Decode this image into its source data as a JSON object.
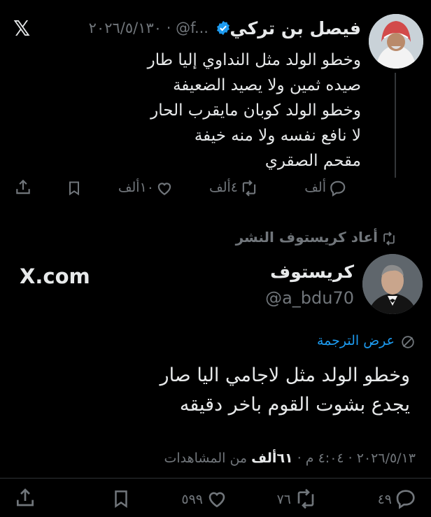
{
  "quoted_tweet": {
    "author_name": "فيصل بن تركي",
    "handle": "@f...",
    "date": "٢٠٢٦/٥/١٣٠",
    "platform_icon": "x-logo",
    "lines": [
      "وخطو الولد مثل النداوي إليا طار",
      "صيده ثمين ولا يصيد الضعيفة",
      "وخطو الولد كوبان مايقرب الحار",
      "لا نافع نفسه ولا منه خيفة",
      "مقحم الصقري"
    ],
    "actions": {
      "reply_count": "ألف",
      "retweet_count": "٤ألف",
      "like_count": "١٠ألف"
    }
  },
  "retweet_note": "أعاد كريستوف النشر",
  "tweet": {
    "author_name": "كريستوف",
    "handle": "@a_bdu70",
    "watermark": "X.com",
    "translate_label": "عرض الترجمة",
    "lines": [
      "وخطو الولد مثل لاجامي اليا صار",
      "يجدع بشوت القوم باخر دقيقه"
    ],
    "meta": {
      "time": "٤:٠٤ م",
      "date": "٢٠٢٦/٥/١٣",
      "views_count": "٦١ألف",
      "views_label": "من المشاهدات"
    },
    "actions": {
      "reply_count": "٤٩",
      "retweet_count": "٧٦",
      "like_count": "٥٩٩"
    }
  },
  "colors": {
    "background": "#000000",
    "text": "#e7e9ea",
    "muted": "#71767b",
    "link": "#1d9bf0",
    "verified": "#1d9bf0"
  }
}
